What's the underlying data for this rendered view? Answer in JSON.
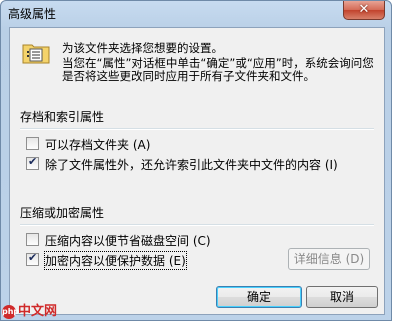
{
  "window": {
    "title": "高级属性",
    "close_glyph": "✕"
  },
  "description": {
    "line1": "为该文件夹选择您想要的设置。",
    "line2": "当您在“属性”对话框中单击“确定”或“应用”时，系统会询问您是否将这些更改同时应用于所有子文件夹和文件。"
  },
  "archive_group": {
    "title": "存档和索引属性",
    "options": [
      {
        "label": "可以存档文件夹 (A)",
        "checked": false
      },
      {
        "label": "除了文件属性外，还允许索引此文件夹中文件的内容 (I)",
        "checked": true
      }
    ]
  },
  "compress_group": {
    "title": "压缩或加密属性",
    "options": [
      {
        "label": "压缩内容以便节省磁盘空间 (C)",
        "checked": false
      },
      {
        "label": "加密内容以便保护数据 (E)",
        "checked": true
      }
    ],
    "details_button": "详细信息 (D)"
  },
  "buttons": {
    "ok": "确定",
    "cancel": "取消"
  },
  "watermark": {
    "text": "中文网",
    "logo_text": "php"
  },
  "icons": [
    "folder-properties-icon",
    "close-icon",
    "checkbox-icon"
  ]
}
